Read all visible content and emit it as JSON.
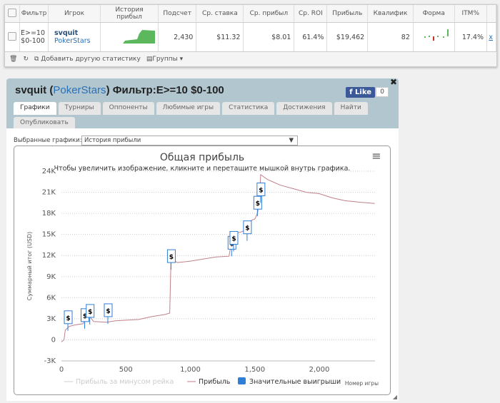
{
  "table": {
    "headers": [
      "Фильтр",
      "Игрок",
      "История прибыл",
      "Подсчет",
      "Ср. ставка",
      "Ср. прибыл",
      "Ср. ROI",
      "Прибыль",
      "Квалифик",
      "Форма",
      "ITM%"
    ],
    "row": {
      "filter": "E>=10 $0-100",
      "player": "svquit",
      "site": "PokerStars",
      "count": "2,430",
      "avg_stake": "$11.32",
      "avg_profit": "$8.01",
      "roi": "61.4%",
      "profit": "$19,462",
      "qualif": "82",
      "itm": "17.4%",
      "remove": "x"
    },
    "footer": {
      "add_stat": "Добавить другую статистику",
      "groups": "Группы"
    }
  },
  "dialog": {
    "player": "svquit",
    "site": "PokerStars",
    "filter": "Фильтр:E>=10 $0-100",
    "like": "Like",
    "like_count": "0",
    "tabs": [
      "Графики",
      "Турниры",
      "Оппоненты",
      "Любимые игры",
      "Статистика",
      "Достижения",
      "Найти",
      "Опубликовать"
    ],
    "select_label": "Выбранные графики:",
    "select_value": "История прибыли"
  },
  "chart_data": {
    "type": "line",
    "title": "Общая прибыль",
    "subtitle": "Чтобы увеличить изображение, кликните и перетащите мышкой внутрь графика.",
    "ylabel": "Суммарный итог (USD)",
    "xlabel": "Номер игры",
    "ylim": [
      -3000,
      24000
    ],
    "xlim": [
      0,
      2430
    ],
    "yticks": [
      "-3K",
      "0",
      "3K",
      "6K",
      "9K",
      "12K",
      "15K",
      "18K",
      "21K",
      "24K"
    ],
    "xticks": [
      "0",
      "500",
      "1,000",
      "1,500",
      "2,000"
    ],
    "legend": [
      "Прибыль за минусом рейка",
      "Прибыль",
      "Значительные выигрыши"
    ],
    "colors": {
      "profit": "#c0808a",
      "markers": "#2f7ed8"
    },
    "profit": [
      [
        0,
        -300
      ],
      [
        20,
        0
      ],
      [
        30,
        1400
      ],
      [
        60,
        1900
      ],
      [
        100,
        2100
      ],
      [
        170,
        2300
      ],
      [
        180,
        3200
      ],
      [
        220,
        3300
      ],
      [
        250,
        2600
      ],
      [
        350,
        2500
      ],
      [
        420,
        2700
      ],
      [
        500,
        2800
      ],
      [
        600,
        2900
      ],
      [
        700,
        3300
      ],
      [
        800,
        3600
      ],
      [
        840,
        3800
      ],
      [
        850,
        11500
      ],
      [
        900,
        11000
      ],
      [
        1000,
        11200
      ],
      [
        1100,
        11500
      ],
      [
        1200,
        11800
      ],
      [
        1300,
        11900
      ],
      [
        1320,
        14000
      ],
      [
        1335,
        15000
      ],
      [
        1400,
        15400
      ],
      [
        1445,
        15800
      ],
      [
        1450,
        16800
      ],
      [
        1500,
        17200
      ],
      [
        1520,
        18000
      ],
      [
        1535,
        19500
      ],
      [
        1545,
        23500
      ],
      [
        1600,
        22800
      ],
      [
        1700,
        22000
      ],
      [
        1800,
        21500
      ],
      [
        1900,
        21000
      ],
      [
        2000,
        20800
      ],
      [
        2100,
        20200
      ],
      [
        2200,
        19800
      ],
      [
        2300,
        19600
      ],
      [
        2430,
        19400
      ]
    ],
    "big_wins": [
      [
        50,
        2300
      ],
      [
        180,
        2600
      ],
      [
        220,
        3200
      ],
      [
        360,
        3300
      ],
      [
        850,
        11000
      ],
      [
        1320,
        12900
      ],
      [
        1335,
        13600
      ],
      [
        1440,
        15100
      ],
      [
        1520,
        18600
      ],
      [
        1545,
        20500
      ]
    ]
  }
}
